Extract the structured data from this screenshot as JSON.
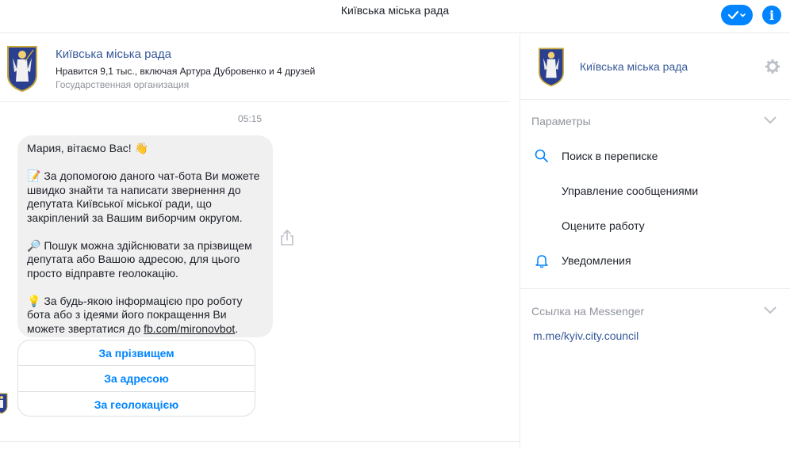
{
  "topbar": {
    "title": "Київська міська рада",
    "check_icon": "check-dropdown-icon",
    "info_icon": "info-icon",
    "info_glyph": "i",
    "accent_color": "#0084ff"
  },
  "chat": {
    "header": {
      "page_name": "Київська міська рада",
      "likes": "Нравится 9,1 тыс., включая Артура Дубровенко и 4 друзей",
      "category": "Государственная организация"
    },
    "timestamp": "05:15",
    "message": {
      "line1": "Мария, вітаємо Вас! 👋",
      "para2": "📝 За допомогою даного чат-бота Ви можете швидко знайти та написати звернення до депутата Київської міської ради, що закріплений за Вашим виборчим округом.",
      "para3": "🔎 Пошук можна здійснювати за прізвищем депутата або Вашою адресою, для цього просто відправте геолокацію.",
      "para4": "💡 За будь-якою інформацією про роботу бота або з ідеями його покращення Ви можете звертатися до",
      "link": "fb.com/mironovbot",
      "tail": "."
    },
    "quick_replies": [
      "За прізвищем",
      "За адресою",
      "За геолокацією"
    ]
  },
  "info": {
    "page_name": "Київська міська рада",
    "params_label": "Параметры",
    "menu": [
      {
        "label": "Поиск в переписке",
        "icon": "search-icon"
      },
      {
        "label": "Управление сообщениями",
        "icon": ""
      },
      {
        "label": "Оцените работу",
        "icon": ""
      },
      {
        "label": "Уведомления",
        "icon": "bell-icon"
      }
    ],
    "messenger_label": "Ссылка на Messenger",
    "messenger_link": "m.me/kyiv.city.council"
  },
  "colors": {
    "link": "#365899",
    "button_text": "#0084ff",
    "muted": "#90949c",
    "bubble": "#f1f0f0"
  }
}
